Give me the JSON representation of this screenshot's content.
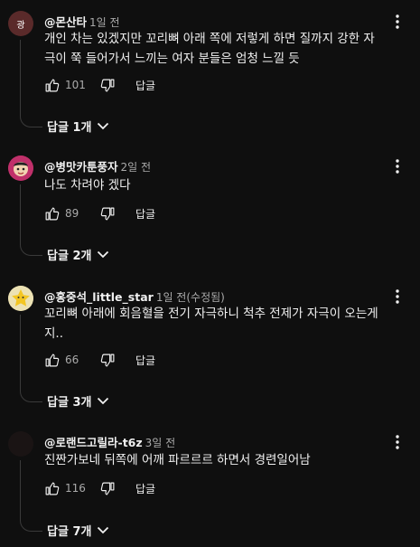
{
  "comments": [
    {
      "avatar_text": "광",
      "avatar_color": "#5a2a2a",
      "author": "@몬산타",
      "time": "1일 전",
      "text": "개인 차는 있겠지만 꼬리뼈 아래 쪽에 저렇게 하면 질까지 강한 자극이 쭉 들어가서 느끼는 여자 분들은 엄청 느낄 듯",
      "likes": "101",
      "reply_label": "답글",
      "replies_label": "답글 1개"
    },
    {
      "avatar_text": "",
      "avatar_color": "#c0306a",
      "author": "@병맛카툰풍자",
      "time": "2일 전",
      "text": "나도 차려야 겠다",
      "likes": "89",
      "reply_label": "답글",
      "replies_label": "답글 2개"
    },
    {
      "avatar_text": "",
      "avatar_color": "#e8d8a0",
      "author": "@홍중석_little_star",
      "time": "1일 전(수정됨)",
      "text": "꼬리뼈 아래에 회음혈을 전기 자극하니 척추 전제가 자극이 오는게지..",
      "likes": "66",
      "reply_label": "답글",
      "replies_label": "답글 3개"
    },
    {
      "avatar_text": "",
      "avatar_color": "#1a1414",
      "author": "@로랜드고릴라-t6z",
      "time": "3일 전",
      "text": "진짠가보네 뒤쪽에 어깨 파르르르 하면서 경련일어남",
      "likes": "116",
      "reply_label": "답글",
      "replies_label": "답글 7개"
    }
  ],
  "icons": {
    "like": "thumbs-up-icon",
    "dislike": "thumbs-down-icon",
    "more": "more-vert-icon",
    "expand": "chevron-down-icon"
  }
}
